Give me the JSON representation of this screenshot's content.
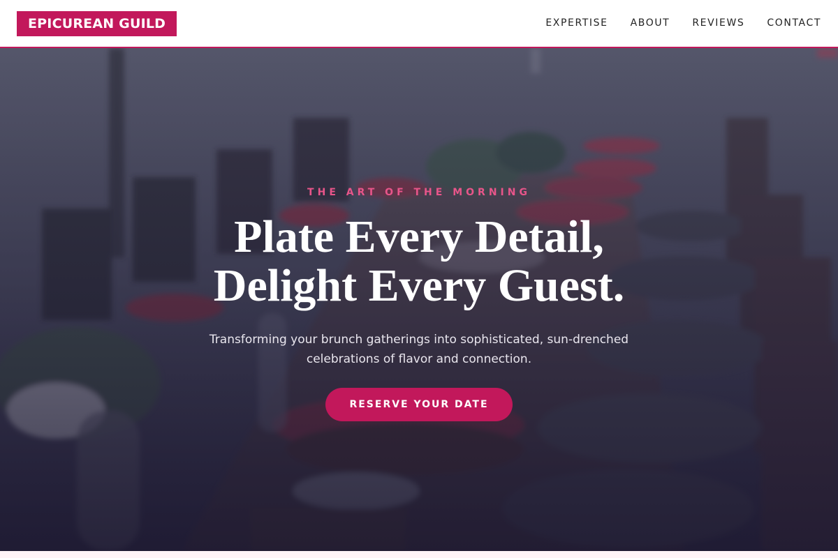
{
  "brand": {
    "name": "EPICUREAN GUILD",
    "color": "#c2185b"
  },
  "nav": {
    "items": [
      {
        "label": "EXPERTISE"
      },
      {
        "label": "ABOUT"
      },
      {
        "label": "REVIEWS"
      },
      {
        "label": "CONTACT"
      }
    ]
  },
  "hero": {
    "eyebrow": "THE ART OF THE MORNING",
    "headline_line1": "Plate Every Detail,",
    "headline_line2": "Delight Every Guest.",
    "subtext": "Transforming your brunch gatherings into sophisticated, sun-drenched celebrations of flavor and connection.",
    "cta_label": "RESERVE YOUR DATE",
    "background": "blurred outdoor brunch table with chairs, wine glasses and red napkins"
  },
  "colors": {
    "accent": "#c2185b",
    "eyebrow": "#e8558a"
  }
}
